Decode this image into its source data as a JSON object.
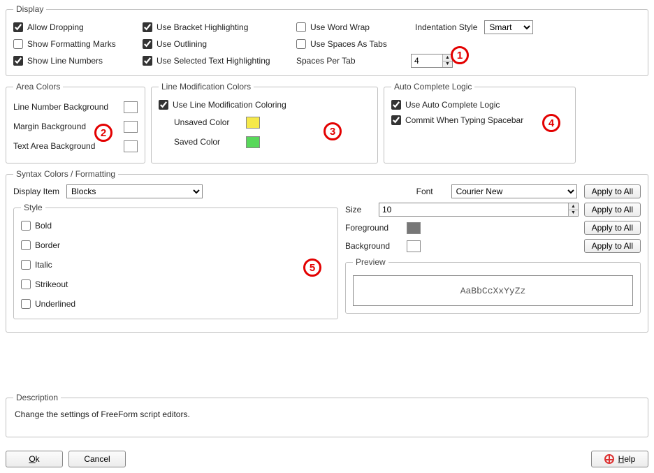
{
  "display": {
    "legend": "Display",
    "allow_dropping": "Allow Dropping",
    "show_formatting_marks": "Show Formatting Marks",
    "show_line_numbers": "Show Line Numbers",
    "use_bracket_highlighting": "Use Bracket Highlighting",
    "use_outlining": "Use Outlining",
    "use_selected_text_highlighting": "Use Selected Text Highlighting",
    "use_word_wrap": "Use Word Wrap",
    "use_spaces_as_tabs": "Use Spaces As Tabs",
    "spaces_per_tab_label": "Spaces Per Tab",
    "spaces_per_tab_value": "4",
    "indentation_style_label": "Indentation Style",
    "indentation_style_value": "Smart"
  },
  "area_colors": {
    "legend": "Area Colors",
    "line_number_bg_label": "Line Number Background",
    "line_number_bg_color": "#ffffff",
    "margin_bg_label": "Margin Background",
    "margin_bg_color": "#ffffff",
    "text_area_bg_label": "Text Area Background",
    "text_area_bg_color": "#ffffff"
  },
  "line_mod": {
    "legend": "Line Modification Colors",
    "use_line_mod_coloring": "Use Line Modification Coloring",
    "unsaved_label": "Unsaved Color",
    "unsaved_color": "#f6e94a",
    "saved_label": "Saved Color",
    "saved_color": "#58d85a"
  },
  "auto_complete": {
    "legend": "Auto Complete Logic",
    "use_auto_complete": "Use Auto Complete Logic",
    "commit_spacebar": "Commit When Typing Spacebar"
  },
  "syntax": {
    "legend": "Syntax Colors / Formatting",
    "display_item_label": "Display Item",
    "display_item_value": "Blocks",
    "style_legend": "Style",
    "bold": "Bold",
    "border": "Border",
    "italic": "Italic",
    "strikeout": "Strikeout",
    "underlined": "Underlined",
    "font_label": "Font",
    "font_value": "Courier New",
    "size_label": "Size",
    "size_value": "10",
    "foreground_label": "Foreground",
    "foreground_color": "#777777",
    "background_label": "Background",
    "background_color": "#ffffff",
    "apply_to_all": "Apply to All",
    "preview_legend": "Preview",
    "preview_text": "AaBbCcXxYyZz"
  },
  "description": {
    "legend": "Description",
    "text": "Change the settings of FreeForm script editors."
  },
  "footer": {
    "ok": "Ok",
    "cancel": "Cancel",
    "help": "Help"
  },
  "annotations": {
    "1": "1",
    "2": "2",
    "3": "3",
    "4": "4",
    "5": "5"
  }
}
